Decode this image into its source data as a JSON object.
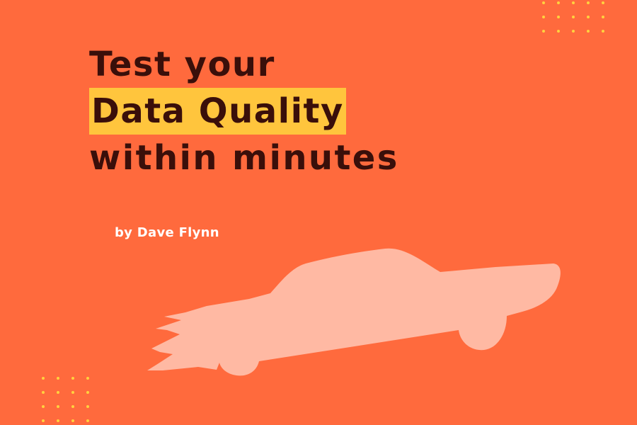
{
  "headline": {
    "line1": "Test your",
    "line2_highlight": "Data Quality",
    "line3": "within minutes"
  },
  "byline": "by Dave Flynn",
  "colors": {
    "background": "#ff6a3d",
    "text": "#3a0f0a",
    "highlight": "#ffc53d",
    "dots": "#ffd23f",
    "car": "#ffb9a3"
  },
  "decorations": {
    "top_dot_grid": {
      "cols": 5,
      "rows": 3
    },
    "bottom_dot_grid": {
      "cols": 4,
      "rows": 4
    },
    "illustration": "car-silhouette-icon"
  }
}
